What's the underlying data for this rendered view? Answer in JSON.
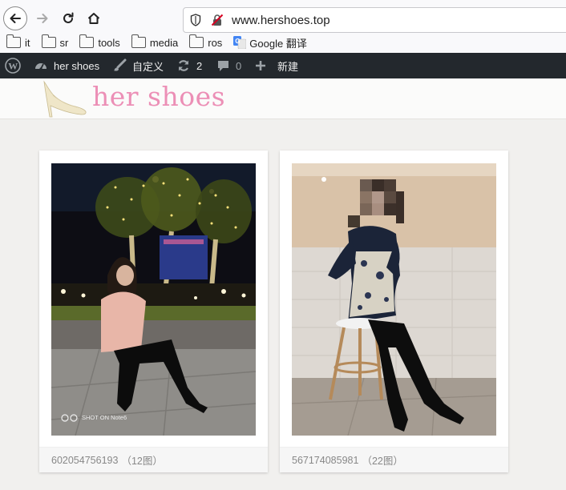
{
  "browser": {
    "url_host": "www.hershoes.top",
    "bookmarks": [
      {
        "label": "it"
      },
      {
        "label": "sr"
      },
      {
        "label": "tools"
      },
      {
        "label": "media"
      },
      {
        "label": "ros"
      },
      {
        "label": "Google 翻译"
      }
    ]
  },
  "adminbar": {
    "site_name": "her shoes",
    "customize": "自定义",
    "updates_count": "2",
    "comments_count": "0",
    "new_label": "新建"
  },
  "site": {
    "title": "her shoes"
  },
  "posts": [
    {
      "id": "602054756193",
      "count": "（12图）",
      "watermark": "SHOT ON Note6"
    },
    {
      "id": "567174085981",
      "count": "（22图）"
    }
  ]
}
